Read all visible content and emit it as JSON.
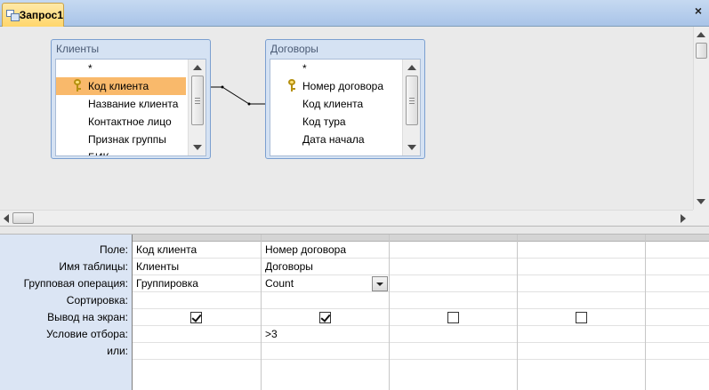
{
  "window": {
    "tab_title": "Запрос1",
    "close": "×"
  },
  "tables": [
    {
      "name": "Клиенты",
      "fields": [
        "*",
        "Код клиента",
        "Название клиента",
        "Контактное лицо",
        "Признак группы",
        "БИК"
      ],
      "key_field": "Код клиента",
      "selected_field": "Код клиента"
    },
    {
      "name": "Договоры",
      "fields": [
        "*",
        "Номер договора",
        "Код клиента",
        "Код тура",
        "Дата начала"
      ],
      "key_field": "Номер договора"
    }
  ],
  "grid": {
    "row_labels": [
      "Поле:",
      "Имя таблицы:",
      "Групповая операция:",
      "Сортировка:",
      "Вывод на экран:",
      "Условие отбора:",
      "или:"
    ],
    "columns": [
      {
        "field": "Код клиента",
        "table": "Клиенты",
        "total": "Группировка",
        "sort": "",
        "show": true,
        "criteria": "",
        "or": ""
      },
      {
        "field": "Номер договора",
        "table": "Договоры",
        "total": "Count",
        "sort": "",
        "show": true,
        "criteria": ">3",
        "or": ""
      },
      {
        "field": "",
        "table": "",
        "total": "",
        "sort": "",
        "show": false,
        "criteria": "",
        "or": ""
      },
      {
        "field": "",
        "table": "",
        "total": "",
        "sort": "",
        "show": false,
        "criteria": "",
        "or": ""
      },
      {
        "field": "",
        "table": "",
        "total": "",
        "sort": "",
        "show": false,
        "criteria": "",
        "or": ""
      }
    ]
  }
}
